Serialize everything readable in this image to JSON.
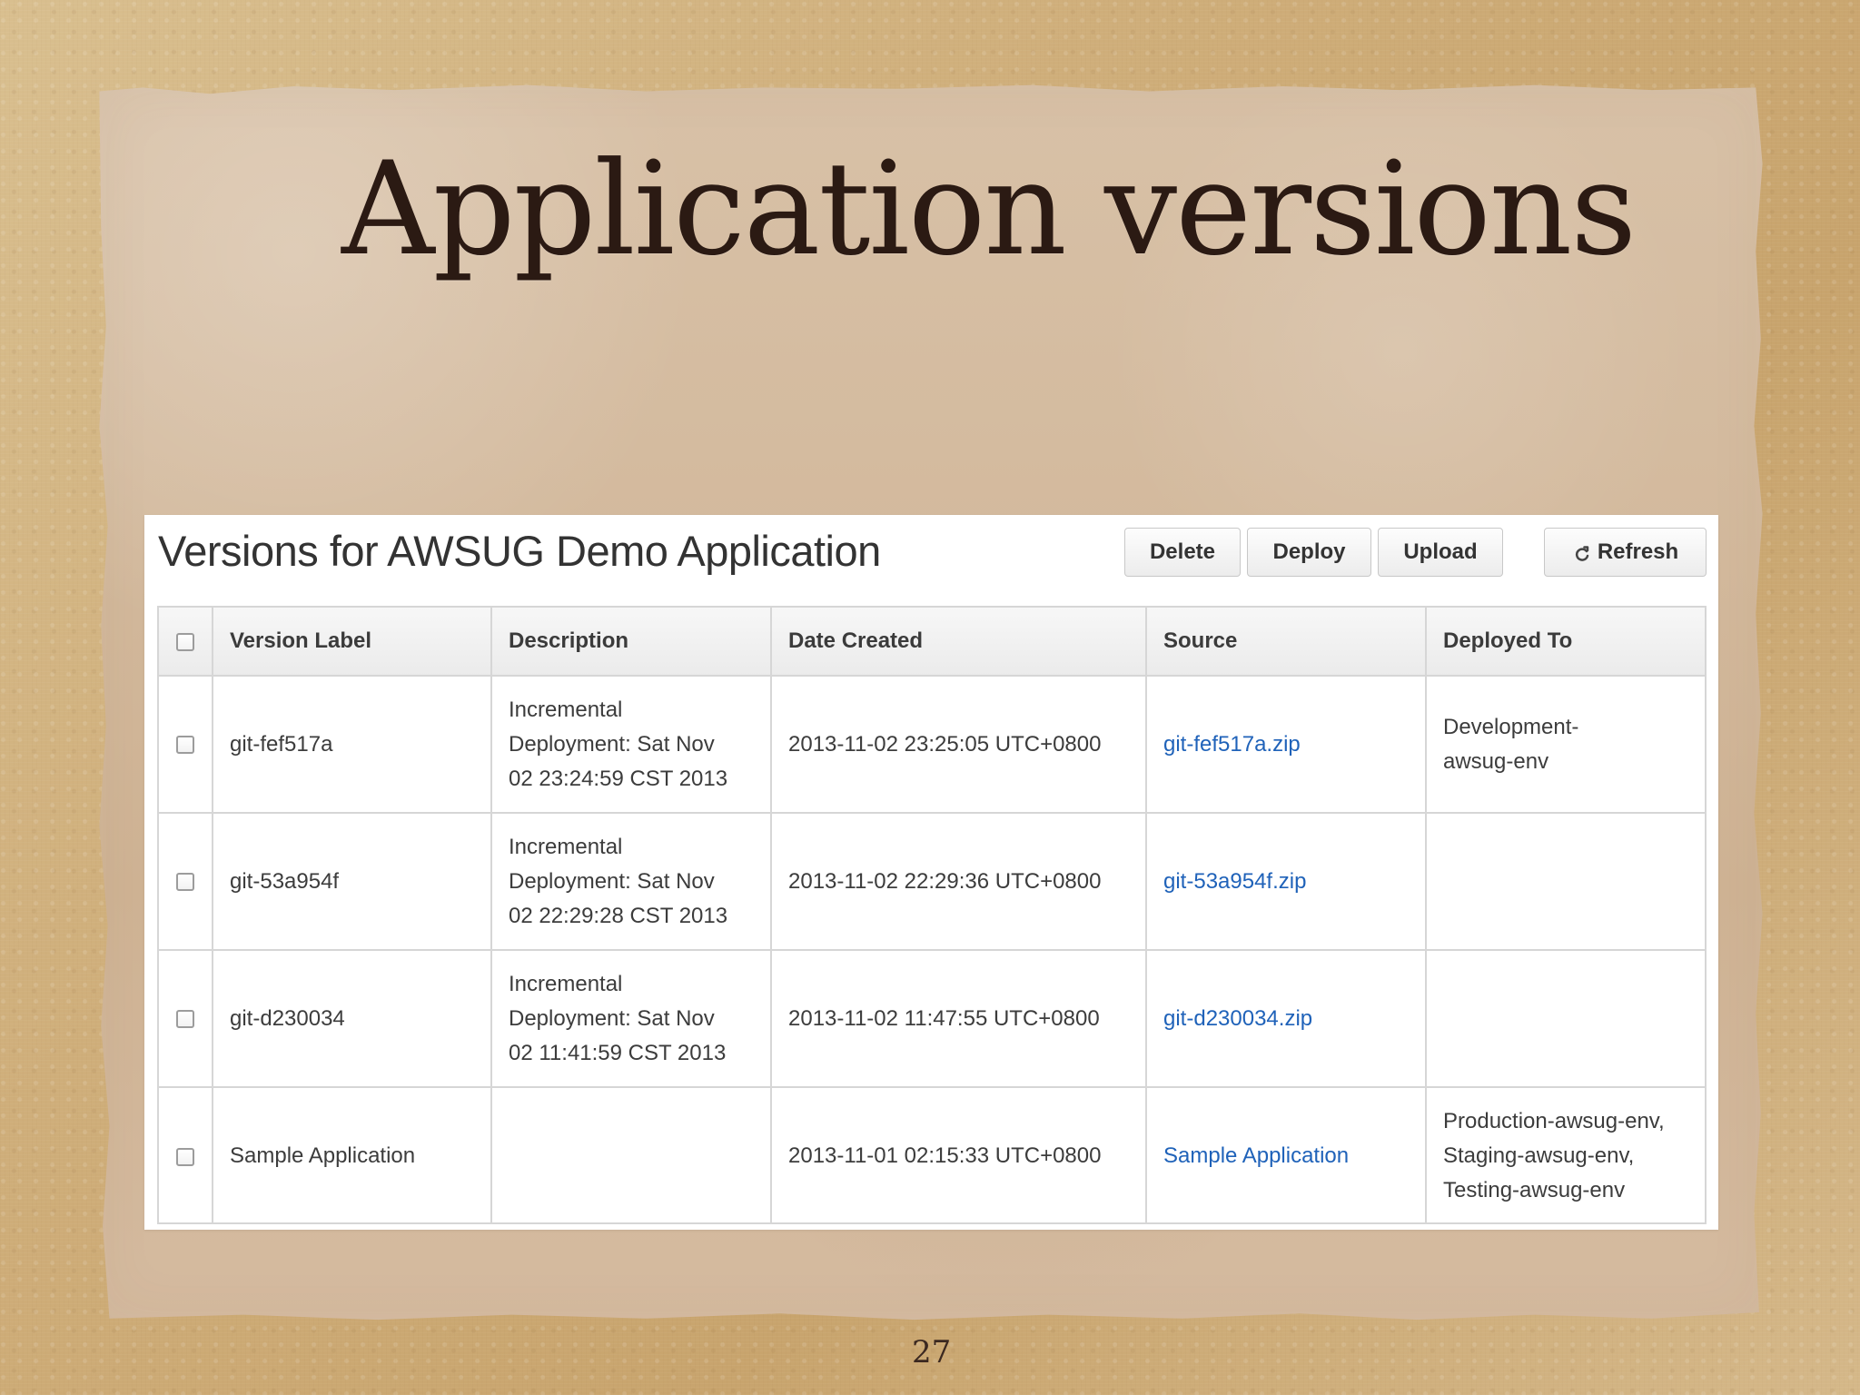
{
  "slide": {
    "title": "Application versions",
    "page_number": "27"
  },
  "panel": {
    "title": "Versions for AWSUG Demo Application",
    "buttons": {
      "delete": "Delete",
      "deploy": "Deploy",
      "upload": "Upload",
      "refresh": "Refresh"
    },
    "icons": {
      "refresh": "refresh-icon",
      "checkbox": "checkbox-icon"
    },
    "table": {
      "headers": {
        "version_label": "Version Label",
        "description": "Description",
        "date_created": "Date Created",
        "source": "Source",
        "deployed_to": "Deployed To"
      },
      "rows": [
        {
          "version_label": "git-fef517a",
          "description": "Incremental\nDeployment: Sat Nov\n02 23:24:59 CST 2013",
          "date_created": "2013-11-02 23:25:05 UTC+0800",
          "source": "git-fef517a.zip",
          "deployed_to": "Development-\nawsug-env"
        },
        {
          "version_label": "git-53a954f",
          "description": "Incremental\nDeployment: Sat Nov\n02 22:29:28 CST 2013",
          "date_created": "2013-11-02 22:29:36 UTC+0800",
          "source": "git-53a954f.zip",
          "deployed_to": ""
        },
        {
          "version_label": "git-d230034",
          "description": "Incremental\nDeployment: Sat Nov\n02 11:41:59 CST 2013",
          "date_created": "2013-11-02 11:47:55 UTC+0800",
          "source": "git-d230034.zip",
          "deployed_to": ""
        },
        {
          "version_label": "Sample Application",
          "description": "",
          "date_created": "2013-11-01 02:15:33 UTC+0800",
          "source": "Sample Application",
          "deployed_to": "Production-awsug-env,\nStaging-awsug-env,\nTesting-awsug-env"
        }
      ]
    }
  },
  "colors": {
    "title_text": "#2b1a13",
    "link": "#1f62b9",
    "table_border": "#d6d6d6",
    "paper": "#d4bb9f",
    "board": "#cfae7a"
  }
}
